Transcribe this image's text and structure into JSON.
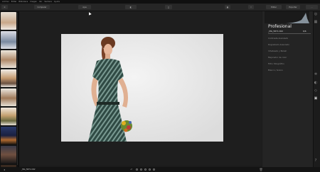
{
  "menu": [
    "Archivo",
    "Editar",
    "Biblioteca",
    "Imagen",
    "Ver",
    "Ventana",
    "Ayuda"
  ],
  "toolbar": {
    "compare_label": "Comparar",
    "zoom_value": "Ajus",
    "btn_a_label": "Editar",
    "btn_b_label": "Exportar"
  },
  "panel": {
    "title": "Profesional",
    "filename": "_MG_5871.CR2",
    "count": "6/6",
    "presets": [
      "Contraste Avanzado",
      "Degradado Avanzado",
      "Viñeteado y Bokeh",
      "Mejorador de color",
      "Filtro fotográfico",
      "Blanco / Grano"
    ]
  },
  "status": {
    "filename": "_MG_5871.CR2"
  },
  "colors": {
    "accent": "#3a8fd6",
    "panel_bg": "#242424",
    "viewer_bg": "#1e1e1e"
  },
  "icons": [
    "menu-icon",
    "arrow-icon",
    "undo-icon",
    "layout-icon",
    "crop-icon",
    "fullscreen-icon",
    "layers-icon",
    "mask-icon",
    "gear-icon",
    "help-icon",
    "trash-icon"
  ]
}
